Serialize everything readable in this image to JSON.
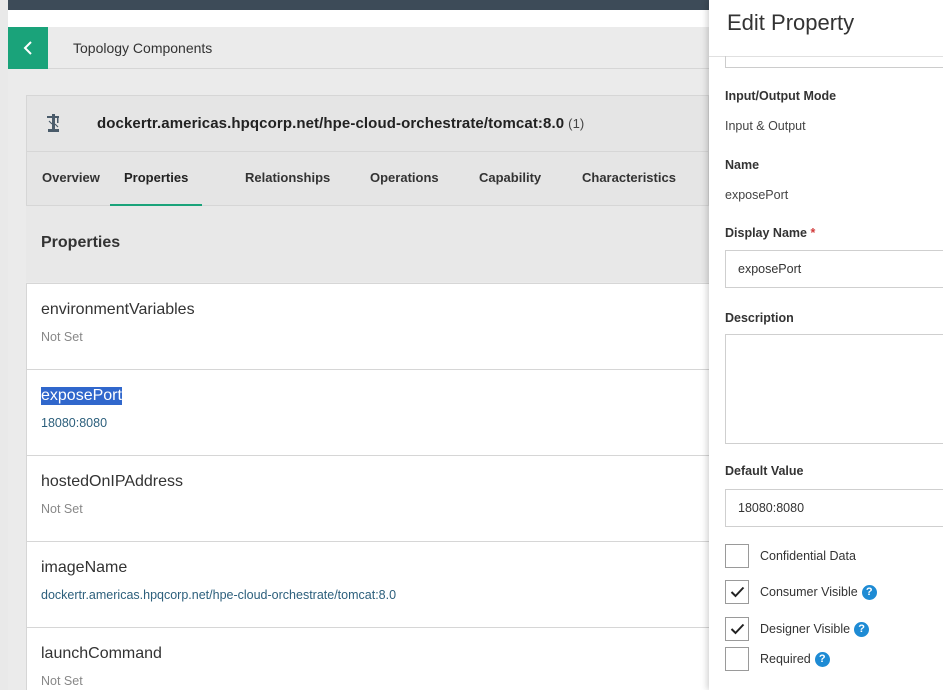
{
  "breadcrumb": {
    "back_label": "‹",
    "title": "Topology Components"
  },
  "component": {
    "icon": "crane-icon",
    "title": "dockertr.americas.hpqcorp.net/hpe-cloud-orchestrate/tomcat:8.0",
    "count": "(1)"
  },
  "tabs": [
    {
      "label": "Overview",
      "active": false
    },
    {
      "label": "Properties",
      "active": true
    },
    {
      "label": "Relationships",
      "active": false
    },
    {
      "label": "Operations",
      "active": false
    },
    {
      "label": "Capability",
      "active": false
    },
    {
      "label": "Characteristics",
      "active": false
    }
  ],
  "properties_heading": "Properties",
  "properties": [
    {
      "name": "environmentVariables",
      "value": "Not Set",
      "is_set": false,
      "selected": false
    },
    {
      "name": "exposePort",
      "value": "18080:8080",
      "is_set": true,
      "selected": true
    },
    {
      "name": "hostedOnIPAddress",
      "value": "Not Set",
      "is_set": false,
      "selected": false
    },
    {
      "name": "imageName",
      "value": "dockertr.americas.hpqcorp.net/hpe-cloud-orchestrate/tomcat:8.0",
      "is_set": true,
      "selected": false
    },
    {
      "name": "launchCommand",
      "value": "Not Set",
      "is_set": false,
      "selected": false
    }
  ],
  "edit_panel": {
    "title": "Edit Property",
    "io_mode": {
      "label": "Input/Output Mode",
      "value": "Input & Output"
    },
    "name": {
      "label": "Name",
      "value": "exposePort"
    },
    "display_name": {
      "label": "Display Name",
      "required_mark": "*",
      "value": "exposePort"
    },
    "description": {
      "label": "Description",
      "value": ""
    },
    "default_value": {
      "label": "Default Value",
      "value": "18080:8080"
    },
    "checkboxes": [
      {
        "label": "Confidential Data",
        "checked": false,
        "help": false
      },
      {
        "label": "Consumer Visible",
        "checked": true,
        "help": true
      },
      {
        "label": "Designer Visible",
        "checked": true,
        "help": true
      },
      {
        "label": "Required",
        "checked": false,
        "help": true
      }
    ],
    "help_glyph": "?"
  },
  "colors": {
    "accent": "#1aa37a",
    "topbar": "#3d4b58",
    "selection": "#3067cc",
    "help": "#1e8bd4",
    "required": "#d13b3b"
  }
}
